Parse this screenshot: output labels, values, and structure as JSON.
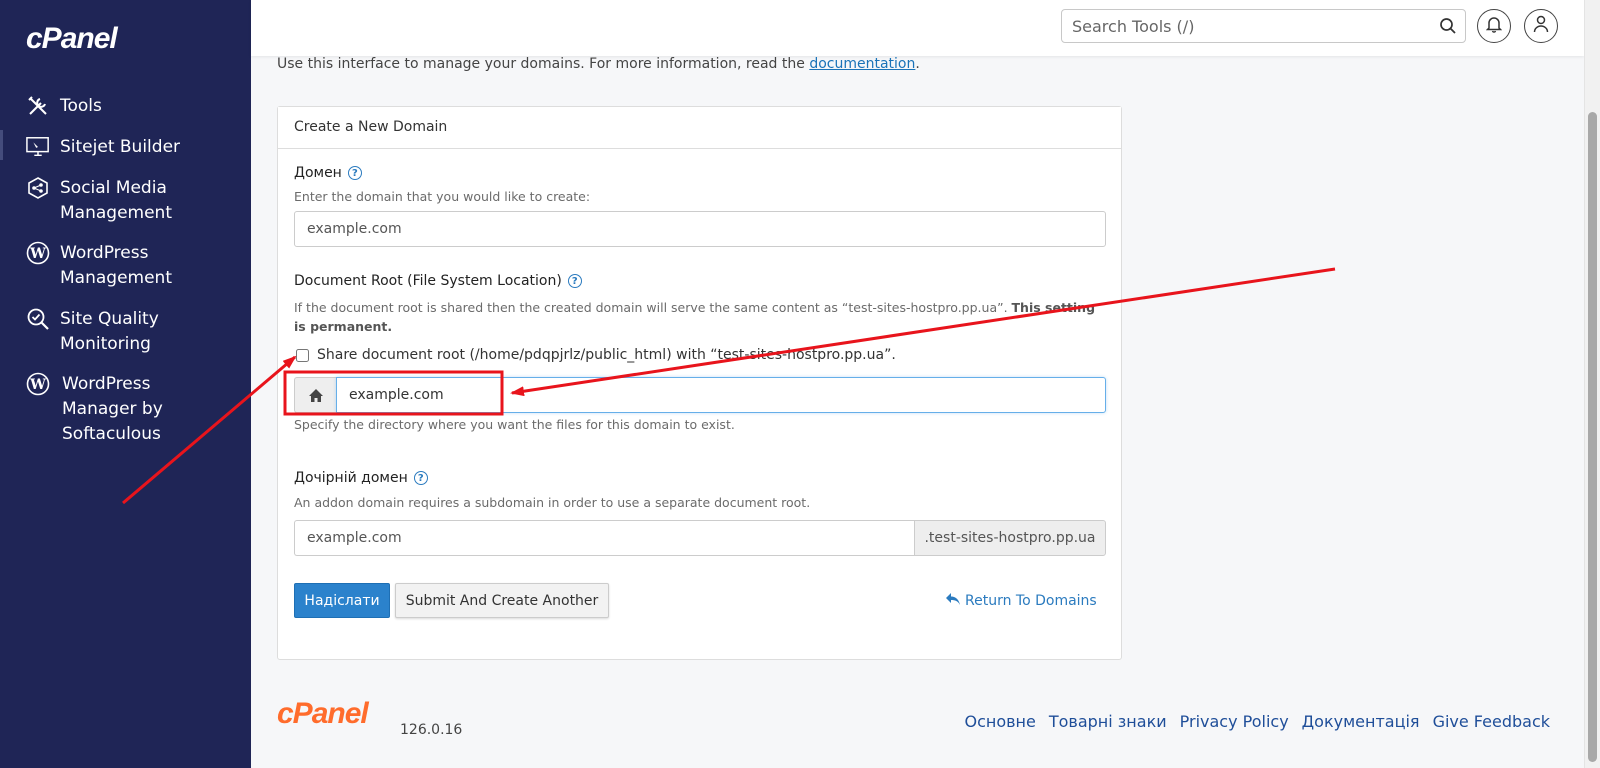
{
  "sidebar": {
    "logo": "cPanel",
    "items": [
      {
        "label": "Tools",
        "icon": "tools-icon"
      },
      {
        "label": "Sitejet Builder",
        "icon": "monitor-icon"
      },
      {
        "label": "Social Media\nManagement",
        "icon": "social-icon"
      },
      {
        "label": "WordPress\nManagement",
        "icon": "wordpress-icon"
      },
      {
        "label": "Site Quality\nMonitoring",
        "icon": "magnify-check-icon"
      },
      {
        "label": "WordPress\nManager by\nSoftaculous",
        "icon": "wordpress-icon"
      }
    ]
  },
  "header": {
    "search_placeholder": "Search Tools (/)"
  },
  "main": {
    "intro_text": "Use this interface to manage your domains. For more information, read the ",
    "intro_link": "documentation",
    "intro_end": ".",
    "panel_title": "Create a New Domain",
    "domain_label": "Домен",
    "domain_hint": "Enter the domain that you would like to create:",
    "domain_placeholder": "example.com",
    "docroot_label": "Document Root (File System Location)",
    "docroot_hint": "If the document root is shared then the created domain will serve the same content as “test-sites-hostpro.pp.ua”. ",
    "docroot_hint_bold": "This setting is permanent.",
    "share_checkbox_label": "Share document root (/home/pdqpjrlz/public_html) with “test-sites-hostpro.pp.ua”.",
    "docroot_value": "example.com",
    "docroot_help": "Specify the directory where you want the files for this domain to exist.",
    "subdomain_label": "Дочірній домен",
    "subdomain_hint": "An addon domain requires a subdomain in order to use a separate document root.",
    "subdomain_placeholder": "example.com",
    "subdomain_suffix": ".test-sites-hostpro.pp.ua",
    "submit_label": "Надіслати",
    "submit_another_label": "Submit And Create Another",
    "return_label": "Return To Domains"
  },
  "footer": {
    "logo": "cPanel",
    "version": "126.0.16",
    "links": [
      "Основне",
      "Товарні знаки",
      "Privacy Policy",
      "Документація",
      "Give Feedback"
    ]
  },
  "colors": {
    "sidebar_bg": "#1f2556",
    "primary": "#2b82cc",
    "link": "#2b7bbf",
    "brand_orange": "#ff6c2c",
    "annotation_red": "#e8141c"
  }
}
